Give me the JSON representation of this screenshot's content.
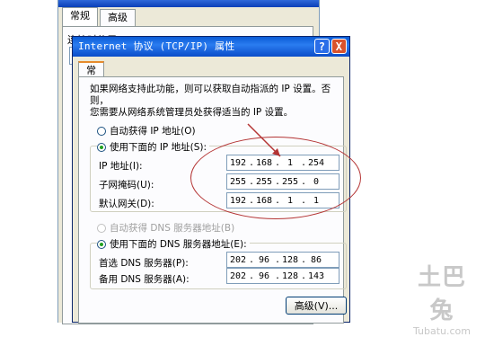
{
  "back_window": {
    "tabs": [
      "常规",
      "高级"
    ],
    "label": "连接时使用："
  },
  "dialog": {
    "title": "Internet 协议 (TCP/IP) 属性",
    "help_glyph": "?",
    "close_glyph": "X",
    "tab_label": "常规",
    "description_line1": "如果网络支持此功能，则可以获取自动指派的 IP 设置。否则，",
    "description_line2": "您需要从网络系统管理员处获得适当的 IP 设置。",
    "ip_options": {
      "auto_label": "自动获得 IP 地址(O)",
      "manual_label": "使用下面的 IP 地址(S):",
      "selected": "manual"
    },
    "ip_fields": [
      {
        "label": "IP 地址(I):",
        "octets": [
          "192",
          "168",
          "1",
          "254"
        ]
      },
      {
        "label": "子网掩码(U):",
        "octets": [
          "255",
          "255",
          "255",
          "0"
        ]
      },
      {
        "label": "默认网关(D):",
        "octets": [
          "192",
          "168",
          "1",
          "1"
        ]
      }
    ],
    "dns_options": {
      "auto_label": "自动获得 DNS 服务器地址(B)",
      "manual_label": "使用下面的 DNS 服务器地址(E):",
      "selected": "manual"
    },
    "dns_fields": [
      {
        "label": "首选 DNS 服务器(P):",
        "octets": [
          "202",
          "96",
          "128",
          "86"
        ]
      },
      {
        "label": "备用 DNS 服务器(A):",
        "octets": [
          "202",
          "96",
          "128",
          "143"
        ]
      }
    ],
    "advanced_button": "高级(V)..."
  },
  "annotation": {
    "color": "#b43434"
  },
  "watermark": {
    "logo": "土巴兔",
    "url": "Tubatu.com"
  }
}
